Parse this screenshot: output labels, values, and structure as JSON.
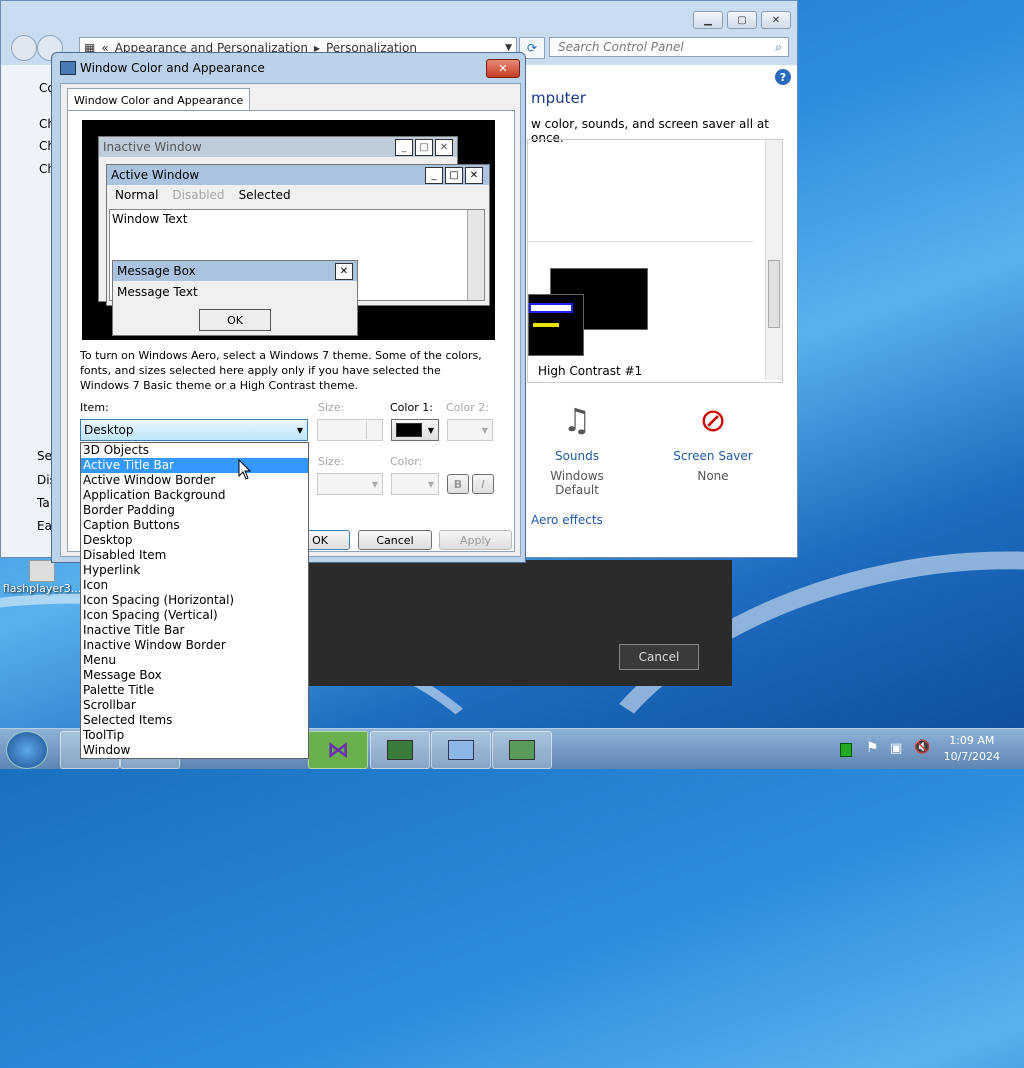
{
  "control_panel": {
    "breadcrumb_prefix": "«",
    "breadcrumb_1": "Appearance and Personalization",
    "breadcrumb_sep": "▸",
    "breadcrumb_2": "Personalization",
    "search_placeholder": "Search Control Panel",
    "heading_fragment": "mputer",
    "subtext_fragment": "w color, sounds, and screen saver all at once.",
    "left_fragments": [
      "Co",
      "Ch",
      "Ch",
      "Ch",
      "Se",
      "Dis",
      "Ta",
      "Ea"
    ],
    "theme_label": "High Contrast #1",
    "sounds_label": "Sounds",
    "sounds_value": "Windows Default",
    "screensaver_label": "Screen Saver",
    "screensaver_value": "None",
    "aero_link": "Aero effects",
    "help_icon": "?"
  },
  "dialog": {
    "title": "Window Color and Appearance",
    "tab_label": "Window Color and Appearance",
    "preview": {
      "inactive_title": "Inactive Window",
      "active_title": "Active Window",
      "menu_normal": "Normal",
      "menu_disabled": "Disabled",
      "menu_selected": "Selected",
      "window_text": "Window Text",
      "message_box_title": "Message Box",
      "message_text": "Message Text",
      "ok_label": "OK"
    },
    "info_text": "To turn on Windows Aero, select a Windows 7 theme.  Some of the colors, fonts, and sizes selected here apply only if you have selected the Windows 7 Basic theme or a High Contrast theme.",
    "item_label": "Item:",
    "item_value": "Desktop",
    "size_label": "Size:",
    "color1_label": "Color 1:",
    "color2_label": "Color 2:",
    "font_size_label": "Size:",
    "font_color_label": "Color:",
    "bold_label": "B",
    "italic_label": "I",
    "ok_button": "OK",
    "cancel_button": "Cancel",
    "apply_button": "Apply"
  },
  "dropdown_items": [
    "3D Objects",
    "Active Title Bar",
    "Active Window Border",
    "Application Background",
    "Border Padding",
    "Caption Buttons",
    "Desktop",
    "Disabled Item",
    "Hyperlink",
    "Icon",
    "Icon Spacing (Horizontal)",
    "Icon Spacing (Vertical)",
    "Inactive Title Bar",
    "Inactive Window Border",
    "Menu",
    "Message Box",
    "Palette Title",
    "Scrollbar",
    "Selected Items",
    "ToolTip",
    "Window"
  ],
  "dropdown_selected_index": 1,
  "background_dialog": {
    "cancel_label": "Cancel"
  },
  "desktop": {
    "icon_label": "flashplayer3..."
  },
  "taskbar": {
    "time": "1:09 AM",
    "date": "10/7/2024"
  },
  "colors": {
    "selection": "#3399ff",
    "color1_swatch": "#000000",
    "link": "#1e5aa8"
  }
}
